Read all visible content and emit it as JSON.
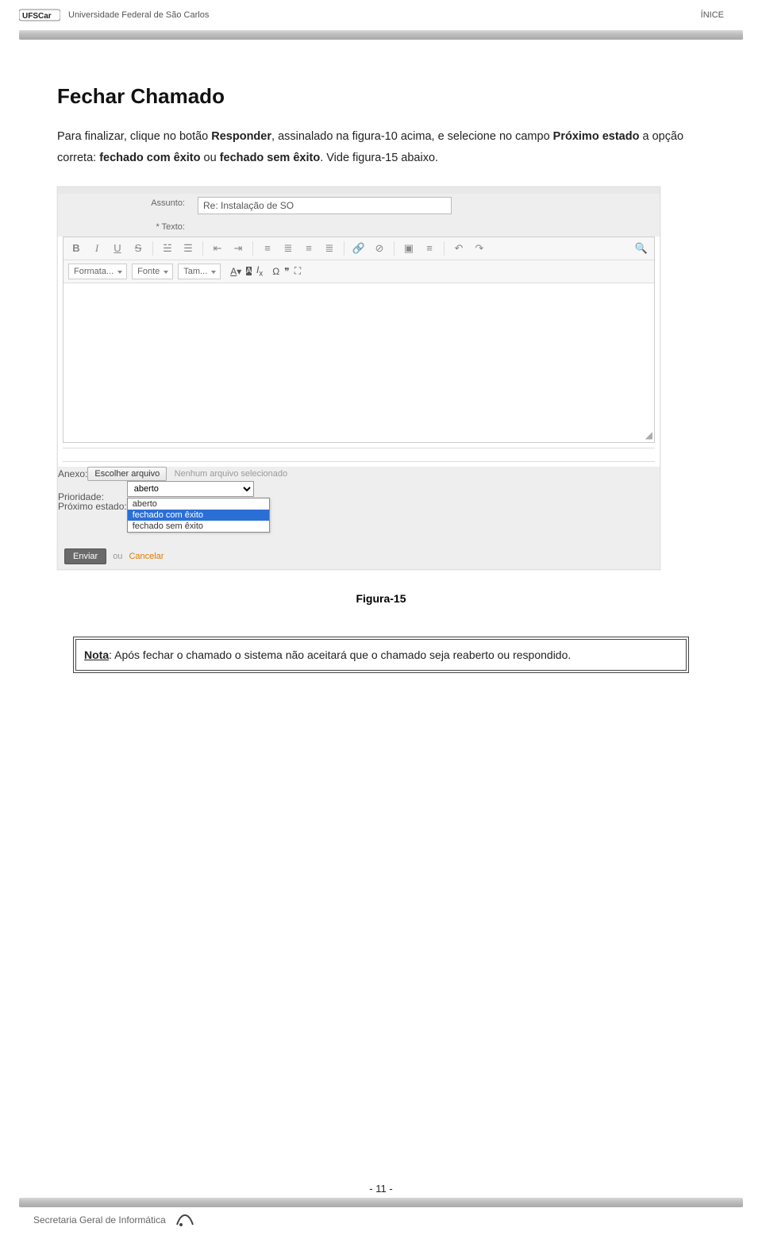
{
  "header": {
    "university": "Universidade Federal de São Carlos",
    "right_label": "ÍNICE"
  },
  "section": {
    "title": "Fechar Chamado",
    "para_pt1": "Para finalizar, clique no botão ",
    "bold_responder": "Responder",
    "para_pt2": ", assinalado na figura-10 acima, e selecione no campo ",
    "bold_proximo": "Próximo estado",
    "para_pt3": " a opção correta: ",
    "bold_fce": "fechado com êxito",
    "para_pt4": " ou ",
    "bold_fse": "fechado sem êxito",
    "para_pt5": ". Vide figura-15 abaixo."
  },
  "form": {
    "assunto_label": "Assunto:",
    "assunto_value": "Re: Instalação de SO",
    "texto_label": "* Texto:",
    "toolbar2": {
      "formata": "Formata...",
      "fonte": "Fonte",
      "tam": "Tam..."
    },
    "anexo_label": "Anexo:",
    "file_button": "Escolher arquivo",
    "file_hint": "Nenhum arquivo selecionado",
    "proximo_label": "Próximo estado:",
    "proximo_selected": "aberto",
    "proximo_options": [
      "aberto",
      "fechado com êxito",
      "fechado sem êxito"
    ],
    "prio_label": "Prioridade:",
    "send": "Enviar",
    "ou": "ou",
    "cancelar": "Cancelar"
  },
  "figure_caption": "Figura-15",
  "note": {
    "prefix": "Nota",
    "text": ": Após fechar o chamado o sistema não aceitará que o chamado seja reaberto ou respondido."
  },
  "footer": {
    "page": "- 11 -",
    "secretaria": "Secretaria Geral de Informática"
  }
}
